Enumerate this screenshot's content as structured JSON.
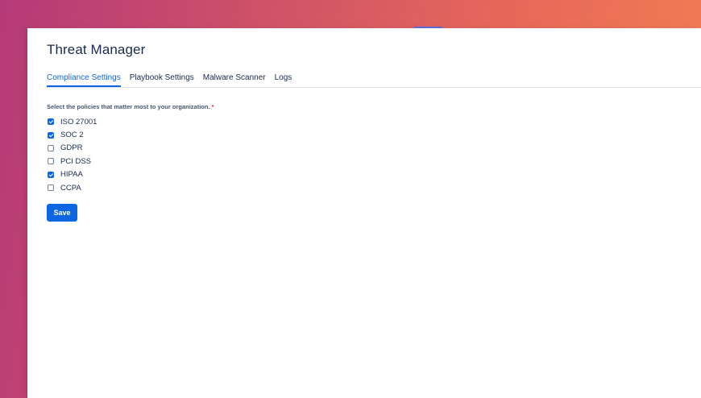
{
  "app": {
    "title": "Threat Manager"
  },
  "tabs": [
    {
      "label": "Compliance Settings",
      "active": true
    },
    {
      "label": "Playbook Settings",
      "active": false
    },
    {
      "label": "Malware Scanner",
      "active": false
    },
    {
      "label": "Logs",
      "active": false
    }
  ],
  "form": {
    "prompt": "Select the policies that matter most to your organization.",
    "required_marker": "*",
    "options": [
      {
        "label": "ISO 27001",
        "checked": true
      },
      {
        "label": "SOC 2",
        "checked": true
      },
      {
        "label": "GDPR",
        "checked": false
      },
      {
        "label": "PCI DSS",
        "checked": false
      },
      {
        "label": "HIPAA",
        "checked": true
      },
      {
        "label": "CCPA",
        "checked": false
      }
    ],
    "save_label": "Save"
  },
  "colors": {
    "accent": "#0c66e4",
    "text_primary": "#172b4d",
    "required": "#c9372c",
    "background_gradient_start": "#b53a78",
    "background_gradient_end": "#f47f52"
  }
}
